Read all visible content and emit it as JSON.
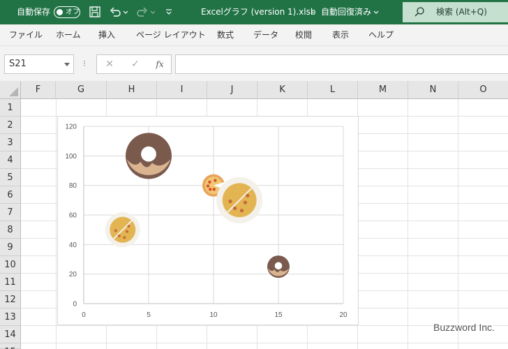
{
  "titlebar": {
    "autosave_label": "自動保存",
    "autosave_state": "オフ",
    "filename": "Excelグラフ (version 1).xlsb",
    "separator": "-",
    "save_status": "自動回復済み",
    "search_label": "検索 (Alt+Q)",
    "colors": {
      "bar": "#217346",
      "search_bg": "#c5e0cf"
    }
  },
  "ribbon": {
    "tabs": [
      "ファイル",
      "ホーム",
      "挿入",
      "ページ レイアウト",
      "数式",
      "データ",
      "校閲",
      "表示",
      "ヘルプ"
    ]
  },
  "formula_bar": {
    "name_box": "S21",
    "cancel_icon": "✕",
    "enter_icon": "✓",
    "function_icon": "fx",
    "formula": ""
  },
  "grid": {
    "columns": [
      "F",
      "G",
      "H",
      "I",
      "J",
      "K",
      "L",
      "M",
      "N",
      "O"
    ],
    "rows": [
      "1",
      "2",
      "3",
      "4",
      "5",
      "6",
      "7",
      "8",
      "9",
      "10",
      "11",
      "12",
      "13",
      "14",
      "15"
    ]
  },
  "chart_data": {
    "type": "scatter",
    "title": "",
    "xlabel": "",
    "ylabel": "",
    "xlim": [
      0,
      20
    ],
    "ylim": [
      0,
      120
    ],
    "x_ticks": [
      "0",
      "5",
      "10",
      "15",
      "20"
    ],
    "y_ticks": [
      "0",
      "20",
      "40",
      "60",
      "80",
      "100",
      "120"
    ],
    "grid": true,
    "points": [
      {
        "x": 5,
        "y": 100,
        "marker": "donut-icon",
        "marker_size": "large"
      },
      {
        "x": 10,
        "y": 80,
        "marker": "pizza-icon",
        "marker_size": "small"
      },
      {
        "x": 12,
        "y": 70,
        "marker": "tortilla-icon",
        "marker_size": "large"
      },
      {
        "x": 3,
        "y": 50,
        "marker": "tortilla-icon",
        "marker_size": "medium"
      },
      {
        "x": 15,
        "y": 25,
        "marker": "donut-icon",
        "marker_size": "small"
      }
    ]
  },
  "watermark": "Buzzword Inc."
}
